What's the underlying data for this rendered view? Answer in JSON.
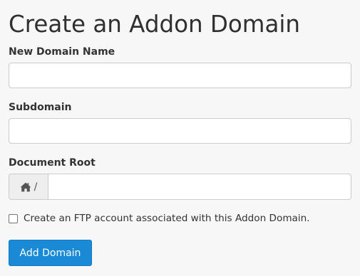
{
  "page": {
    "title": "Create an Addon Domain"
  },
  "form": {
    "new_domain": {
      "label": "New Domain Name",
      "value": "",
      "placeholder": ""
    },
    "subdomain": {
      "label": "Subdomain",
      "value": "",
      "placeholder": ""
    },
    "document_root": {
      "label": "Document Root",
      "prefix_icon": "home-icon",
      "prefix_text": "/",
      "value": "",
      "placeholder": ""
    },
    "ftp_checkbox": {
      "label": "Create an FTP account associated with this Addon Domain.",
      "checked": false
    },
    "submit_label": "Add Domain"
  },
  "colors": {
    "background": "#f7f7f7",
    "primary_button": "#1a8ad6",
    "input_border": "#cccccc",
    "addon_background": "#eeeeee"
  }
}
